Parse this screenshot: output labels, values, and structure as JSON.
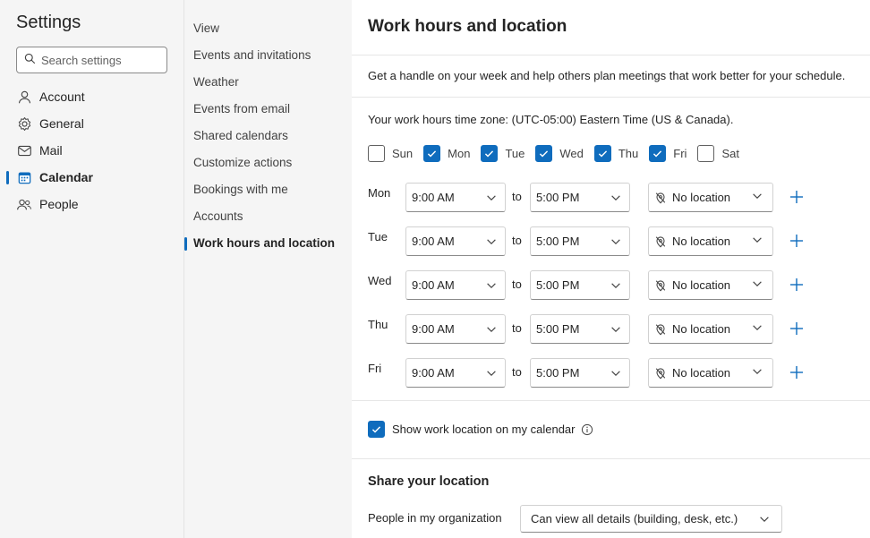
{
  "sidebar": {
    "title": "Settings",
    "search_placeholder": "Search settings",
    "items": [
      {
        "label": "Account",
        "icon": "person-icon"
      },
      {
        "label": "General",
        "icon": "gear-icon"
      },
      {
        "label": "Mail",
        "icon": "mail-icon"
      },
      {
        "label": "Calendar",
        "icon": "calendar-icon",
        "selected": true
      },
      {
        "label": "People",
        "icon": "people-icon"
      }
    ]
  },
  "subnav": {
    "items": [
      {
        "label": "View"
      },
      {
        "label": "Events and invitations"
      },
      {
        "label": "Weather"
      },
      {
        "label": "Events from email"
      },
      {
        "label": "Shared calendars"
      },
      {
        "label": "Customize actions"
      },
      {
        "label": "Bookings with me"
      },
      {
        "label": "Accounts"
      },
      {
        "label": "Work hours and location",
        "selected": true
      }
    ]
  },
  "main": {
    "title": "Work hours and location",
    "intro": "Get a handle on your week and help others plan meetings that work better for your schedule.",
    "timezone": "Your work hours time zone: (UTC-05:00) Eastern Time (US & Canada).",
    "days": [
      {
        "label": "Sun",
        "checked": false
      },
      {
        "label": "Mon",
        "checked": true
      },
      {
        "label": "Tue",
        "checked": true
      },
      {
        "label": "Wed",
        "checked": true
      },
      {
        "label": "Thu",
        "checked": true
      },
      {
        "label": "Fri",
        "checked": true
      },
      {
        "label": "Sat",
        "checked": false
      }
    ],
    "to_label": "to",
    "schedule": [
      {
        "day": "Mon",
        "start": "9:00 AM",
        "end": "5:00 PM",
        "location": "No location"
      },
      {
        "day": "Tue",
        "start": "9:00 AM",
        "end": "5:00 PM",
        "location": "No location"
      },
      {
        "day": "Wed",
        "start": "9:00 AM",
        "end": "5:00 PM",
        "location": "No location"
      },
      {
        "day": "Thu",
        "start": "9:00 AM",
        "end": "5:00 PM",
        "location": "No location"
      },
      {
        "day": "Fri",
        "start": "9:00 AM",
        "end": "5:00 PM",
        "location": "No location"
      }
    ],
    "show_location": {
      "label": "Show work location on my calendar",
      "checked": true
    },
    "share": {
      "heading": "Share your location",
      "label": "People in my organization",
      "value": "Can view all details (building, desk, etc.)"
    }
  },
  "colors": {
    "accent": "#0f6cbd"
  }
}
